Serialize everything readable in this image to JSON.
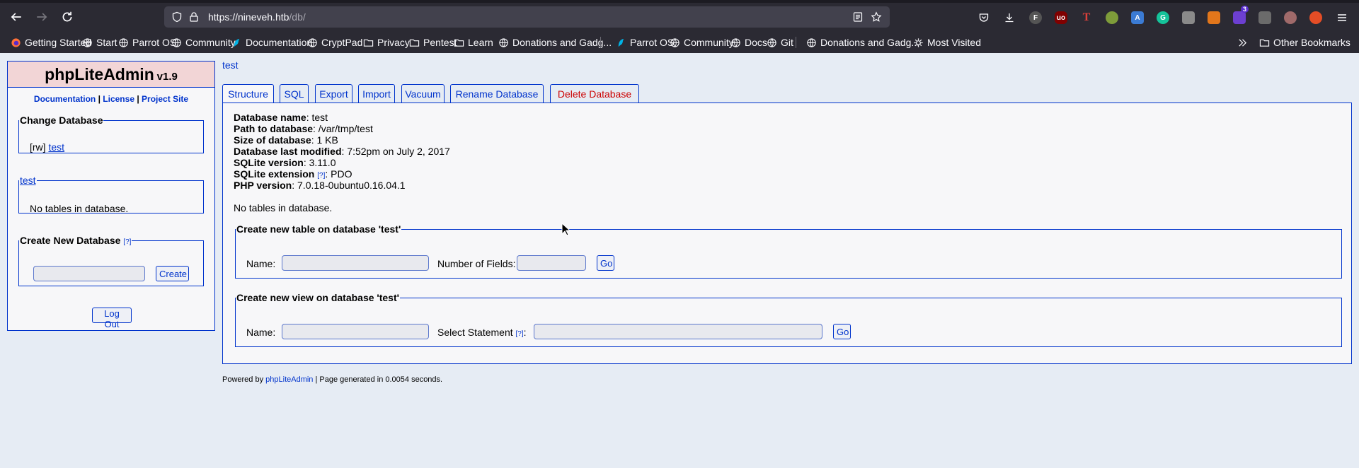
{
  "browser": {
    "url_host": "https://nineveh.htb",
    "url_path": "/db/",
    "bookmarks": [
      {
        "label": "Getting Started",
        "icon": "firefox-icon"
      },
      {
        "label": "Start",
        "icon": "globe-icon"
      },
      {
        "label": "Parrot OS",
        "icon": "globe-icon"
      },
      {
        "label": "Community",
        "icon": "globe-icon"
      },
      {
        "label": "Documentation",
        "icon": "parrot-icon"
      },
      {
        "label": "CryptPad",
        "icon": "globe-icon"
      },
      {
        "label": "Privacy",
        "icon": "folder-icon"
      },
      {
        "label": "Pentest",
        "icon": "folder-icon"
      },
      {
        "label": "Learn",
        "icon": "folder-icon"
      },
      {
        "label": "Donations and Gadg...",
        "icon": "globe-icon"
      },
      {
        "label": "Parrot OS",
        "icon": "parrot-icon"
      },
      {
        "label": "Community",
        "icon": "globe-icon"
      },
      {
        "label": "Docs",
        "icon": "globe-icon"
      },
      {
        "label": "Git",
        "icon": "globe-icon"
      },
      {
        "label": "Donations and Gadg...",
        "icon": "globe-icon"
      },
      {
        "label": "Most Visited",
        "icon": "gear-icon"
      }
    ],
    "other_bookmarks": "Other Bookmarks",
    "extension_badge": "3"
  },
  "app": {
    "name": "phpLiteAdmin",
    "version": "v1.9",
    "links": {
      "documentation": "Documentation",
      "sep": "|",
      "license": "License",
      "project_site": "Project Site"
    }
  },
  "sidebar": {
    "change_db": {
      "legend": "Change Database",
      "mode": "[rw]",
      "db_link": "test"
    },
    "db_box": {
      "legend_link": "test",
      "text": "No tables in database."
    },
    "create_db": {
      "legend": "Create New Database",
      "help": "[?]",
      "button": "Create",
      "input_value": ""
    },
    "logout": "Log Out"
  },
  "main": {
    "db_title": "test",
    "tabs": [
      "Structure",
      "SQL",
      "Export",
      "Import",
      "Vacuum",
      "Rename Database",
      "Delete Database"
    ],
    "info": {
      "name_label": "Database name",
      "name_value": ": test",
      "path_label": "Path to database",
      "path_value": ": /var/tmp/test",
      "size_label": "Size of database",
      "size_value": ": 1 KB",
      "modified_label": "Database last modified",
      "modified_value": ": 7:52pm on July 2, 2017",
      "sqlite_label": "SQLite version",
      "sqlite_value": ": 3.11.0",
      "ext_label": "SQLite extension",
      "ext_help": "[?]",
      "ext_value": ": PDO",
      "php_label": "PHP version",
      "php_value": ": 7.0.18-0ubuntu0.16.04.1"
    },
    "no_tables": "No tables in database.",
    "create_table": {
      "legend": "Create new table on database 'test'",
      "name_label": "Name:",
      "fields_label": "Number of Fields:",
      "go": "Go"
    },
    "create_view": {
      "legend": "Create new view on database 'test'",
      "name_label": "Name:",
      "select_label": "Select Statement",
      "help": "[?]",
      "colon": ":",
      "go": "Go"
    }
  },
  "footer": {
    "prefix": "Powered by ",
    "link": "phpLiteAdmin",
    "suffix": " | Page generated in 0.0054 seconds."
  }
}
